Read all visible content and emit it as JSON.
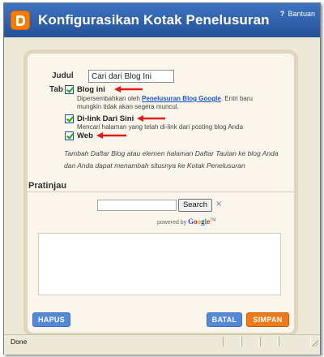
{
  "header": {
    "title": "Konfigurasikan Kotak Penelusuran",
    "help_label": "Bantuan",
    "logo_icon": "blogger-logo-icon"
  },
  "form": {
    "title_label": "Judul",
    "title_value": "Cari dari Blog Ini",
    "tab_label": "Tab",
    "options": [
      {
        "label": "Blog ini",
        "checked": true,
        "desc_before": "Dipersembahkan oleh ",
        "desc_link": "Penelusuran Blog Google",
        "desc_after": ". Entri baru mungkin tidak akan segera muncul."
      },
      {
        "label": "Di-link Dari Sini",
        "checked": true,
        "desc": "Mencari halaman yang telah di-link dari posting blog Anda"
      },
      {
        "label": "Web",
        "checked": true
      }
    ],
    "note": "Tambah Daftar Blog atau elemen halaman Daftar Tautan ke blog Anda dan Anda dapat menambah situsnya ke Kotak Penelusuran"
  },
  "preview": {
    "title": "Pratinjau",
    "search_button": "Search",
    "clear_icon": "×",
    "powered_by": "powered by",
    "google_letters": [
      "G",
      "o",
      "o",
      "g",
      "l",
      "e"
    ],
    "trademark": "TM"
  },
  "buttons": {
    "remove": "HAPUS",
    "cancel": "BATAL",
    "save": "SIMPAN"
  },
  "status": {
    "text": "Done"
  },
  "colors": {
    "header_blue": "#2a5ba6",
    "button_blue": "#5389d6",
    "button_orange": "#ef7a1a",
    "arrow_red": "#e31b1b"
  }
}
